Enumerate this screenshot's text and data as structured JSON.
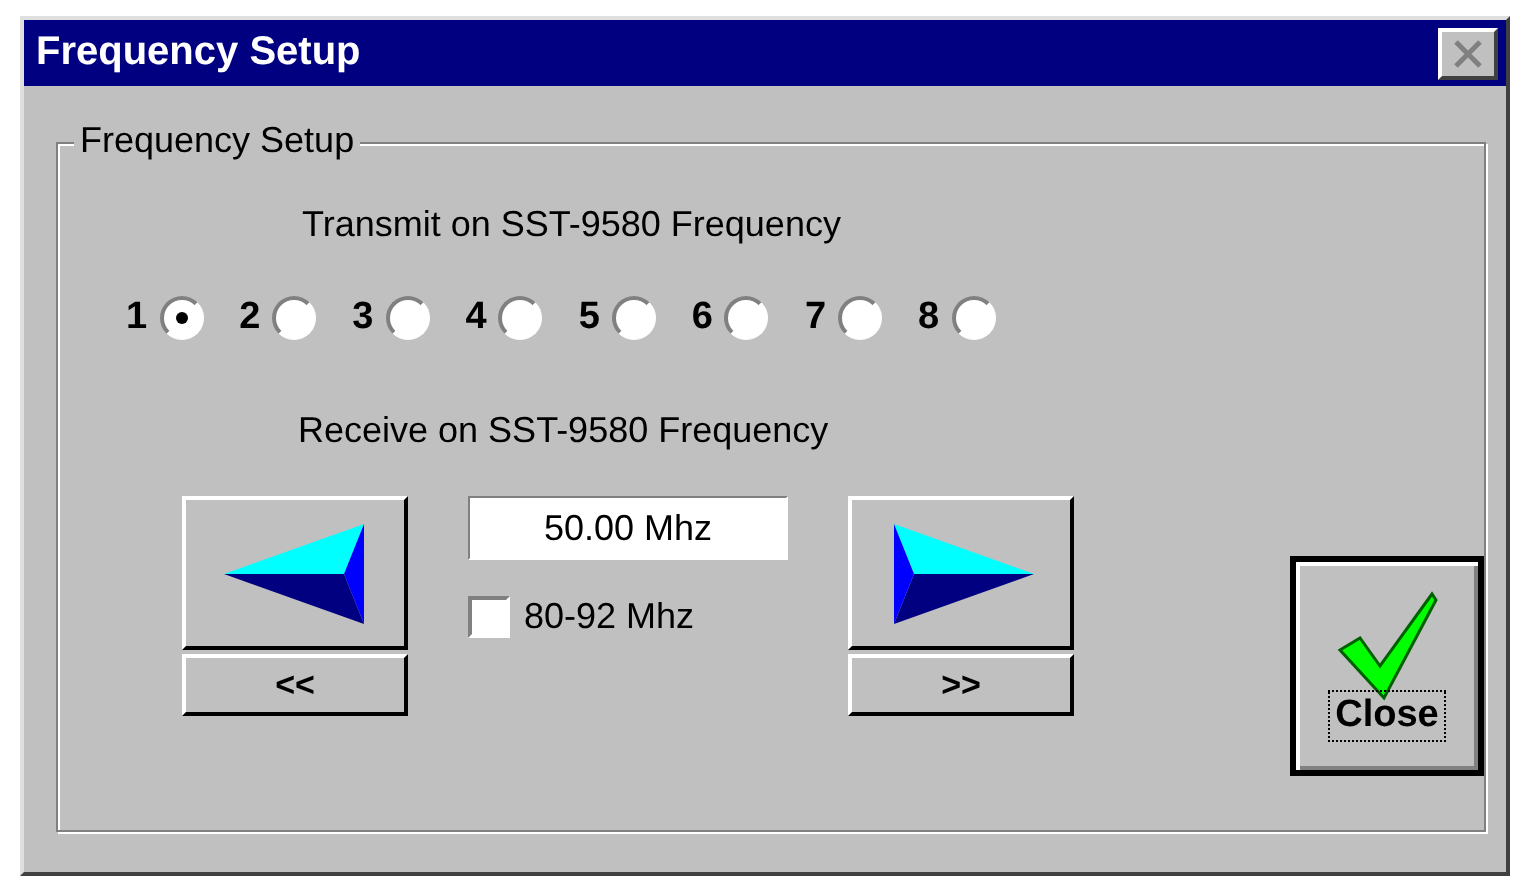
{
  "window": {
    "title": "Frequency Setup"
  },
  "group": {
    "label": "Frequency Setup"
  },
  "transmit": {
    "label": "Transmit on SST-9580 Frequency",
    "options": [
      {
        "label": "1",
        "selected": true
      },
      {
        "label": "2",
        "selected": false
      },
      {
        "label": "3",
        "selected": false
      },
      {
        "label": "4",
        "selected": false
      },
      {
        "label": "5",
        "selected": false
      },
      {
        "label": "6",
        "selected": false
      },
      {
        "label": "7",
        "selected": false
      },
      {
        "label": "8",
        "selected": false
      }
    ]
  },
  "receive": {
    "label": "Receive on SST-9580 Frequency",
    "frequency": {
      "value": "50.00 Mhz"
    },
    "range_checkbox": {
      "label": "80-92 Mhz",
      "checked": false
    },
    "down_button": {
      "label": "<<"
    },
    "up_button": {
      "label": ">>"
    }
  },
  "close_button": {
    "label": "Close"
  }
}
